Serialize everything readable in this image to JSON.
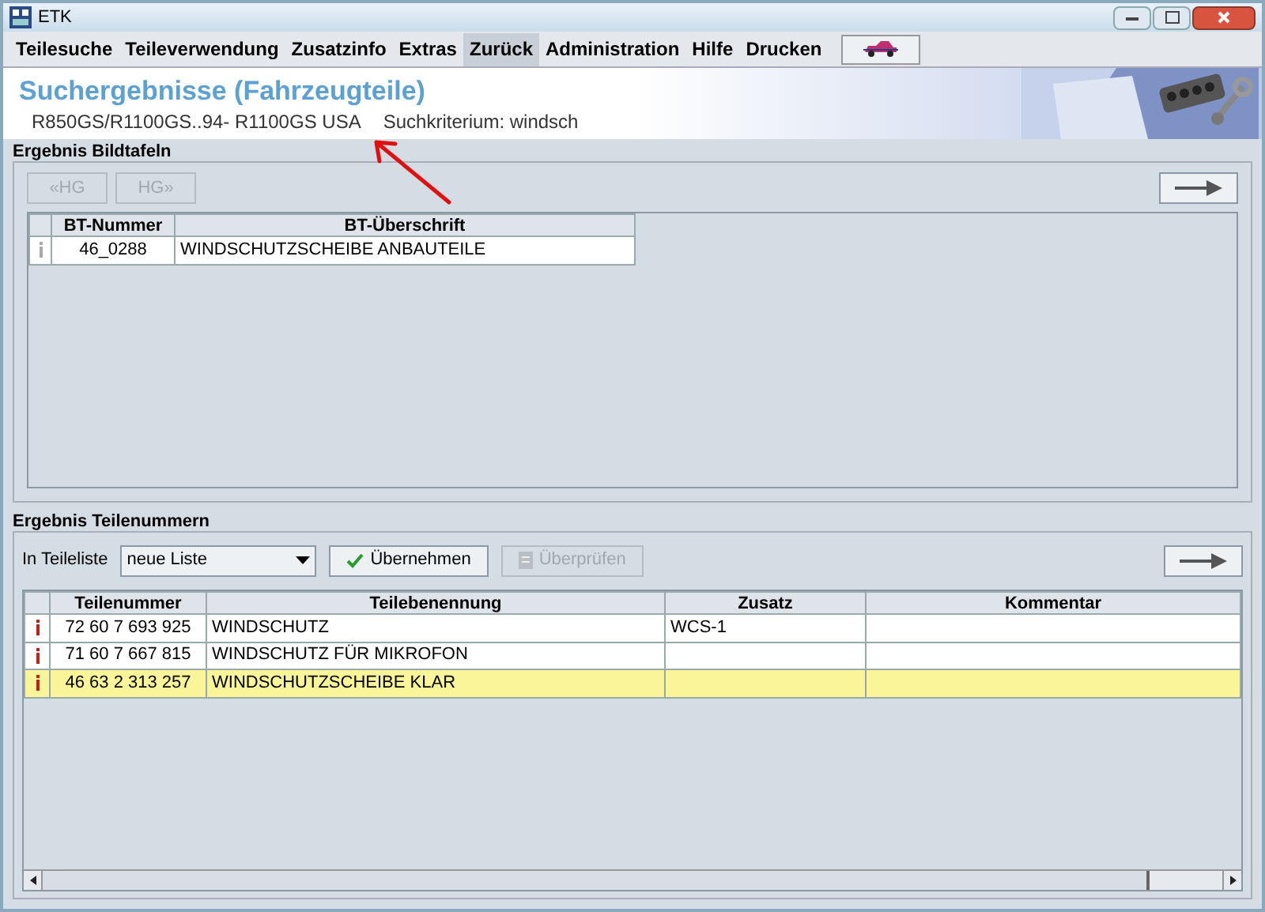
{
  "window": {
    "title": "ETK"
  },
  "menu": [
    {
      "label": "Teilesuche",
      "selected": false
    },
    {
      "label": "Teileverwendung",
      "selected": false
    },
    {
      "label": "Zusatzinfo",
      "selected": false
    },
    {
      "label": "Extras",
      "selected": false
    },
    {
      "label": "Zurück",
      "selected": true
    },
    {
      "label": "Administration",
      "selected": false
    },
    {
      "label": "Hilfe",
      "selected": false
    },
    {
      "label": "Drucken",
      "selected": false
    }
  ],
  "header": {
    "title": "Suchergebnisse (Fahrzeugteile)",
    "vehicle": "R850GS/R1100GS..94- R1100GS USA",
    "criterion": "Suchkriterium: windsch"
  },
  "bildtafeln": {
    "title": "Ergebnis Bildtafeln",
    "nav_buttons": [
      {
        "label": "«HG",
        "disabled": true
      },
      {
        "label": "HG»",
        "disabled": true
      }
    ],
    "columns": [
      "BT-Nummer",
      "BT-Überschrift"
    ],
    "rows": [
      {
        "cells": [
          "46_0288",
          "WINDSCHUTZSCHEIBE ANBAUTEILE"
        ],
        "selected": false
      }
    ]
  },
  "teilenummern": {
    "title": "Ergebnis Teilenummern",
    "list_label": "In Teileliste",
    "list_value": "neue Liste",
    "buttons": [
      {
        "label": "Übernehmen",
        "disabled": false
      },
      {
        "label": "Überprüfen",
        "disabled": true
      }
    ],
    "columns": [
      "Teilenummer",
      "Teilebenennung",
      "Zusatz",
      "Kommentar"
    ],
    "rows": [
      {
        "cells": [
          "72 60 7 693 925",
          "WINDSCHUTZ",
          "WCS-1",
          ""
        ],
        "selected": false
      },
      {
        "cells": [
          "71 60 7 667 815",
          "WINDSCHUTZ FÜR MIKROFON",
          "",
          ""
        ],
        "selected": false
      },
      {
        "cells": [
          "46 63 2 313 257",
          "WINDSCHUTZSCHEIBE KLAR",
          "",
          ""
        ],
        "selected": true
      }
    ]
  }
}
